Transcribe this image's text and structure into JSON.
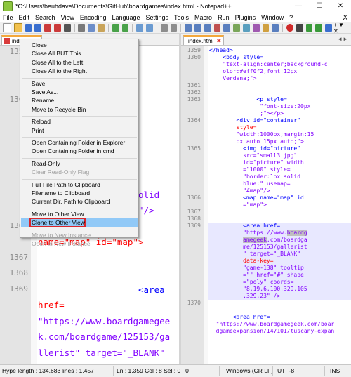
{
  "window": {
    "title": "*C:\\Users\\beuhdave\\Documents\\GitHub\\boardgames\\index.html - Notepad++"
  },
  "menu": [
    "File",
    "Edit",
    "Search",
    "View",
    "Encoding",
    "Language",
    "Settings",
    "Tools",
    "Macro",
    "Run",
    "Plugins",
    "Window",
    "?"
  ],
  "menu_close": "X",
  "toolbar_right_label": "+ ▼ ✕",
  "tabs": {
    "left": {
      "label": "index.h",
      "close": "✖"
    },
    "right": {
      "label": "index.html",
      "close": "✖"
    },
    "nav": "◄►"
  },
  "left_editor": {
    "lines": [
      {
        "num": "1359",
        "frag": [
          {
            "t": "",
            "c": "txt"
          }
        ]
      },
      {
        "num": "",
        "frag": [
          {
            "t": "r;ba",
            "c": "txt"
          }
        ]
      },
      {
        "num": "",
        "frag": [
          {
            "t": "eff0f",
            "c": "txt"
          }
        ]
      },
      {
        "num": "1360",
        "frag": []
      },
      {
        "num": "",
        "frag": [
          {
            "t": "<p",
            "c": "tag"
          }
        ]
      },
      {
        "num": "",
        "frag": [
          {
            "t": "x;\"",
            "c": "val"
          }
        ]
      },
      {
        "num": "",
        "frag": [
          {
            "t": ":15px",
            "c": "val"
          }
        ]
      },
      {
        "num": "",
        "frag": [
          {
            "t": "\" id=",
            "c": "attr"
          }
        ]
      },
      {
        "num": "",
        "frag": [
          {
            "t": "0\"",
            "c": "val"
          }
        ]
      },
      {
        "num": "",
        "frag": [
          {
            "t": "style=\"border:1px solid",
            "c": "val"
          }
        ]
      },
      {
        "num": "",
        "frag": [
          {
            "t": "blue;\" usemap=\"#map\"/>",
            "c": "val"
          }
        ]
      },
      {
        "num": "1366",
        "frag": [
          {
            "t": "               <map",
            "c": "tag"
          }
        ]
      },
      {
        "num": "",
        "frag": [
          {
            "t": "name=\"map\" id=\"map\">",
            "c": "attr"
          }
        ]
      },
      {
        "num": "1367",
        "frag": []
      },
      {
        "num": "1368",
        "frag": []
      },
      {
        "num": "1369",
        "frag": [
          {
            "t": "                   <area",
            "c": "tag"
          }
        ]
      },
      {
        "num": "",
        "frag": [
          {
            "t": "href=",
            "c": "attr"
          }
        ]
      },
      {
        "num": "",
        "frag": [
          {
            "t": "\"https://www.boardgamegee",
            "c": "val"
          }
        ]
      },
      {
        "num": "",
        "frag": [
          {
            "t": "k.com/boardgame/125153/ga",
            "c": "val"
          }
        ]
      },
      {
        "num": "",
        "frag": [
          {
            "t": "llerist\" target=\"_BLANK\"",
            "c": "val"
          }
        ]
      }
    ]
  },
  "right_editor": {
    "lines": [
      {
        "num": "1359",
        "frag": [
          {
            "t": "</head>",
            "c": "tag"
          }
        ]
      },
      {
        "num": "1360",
        "frag": [
          {
            "t": "    <body style=",
            "c": "tag"
          }
        ]
      },
      {
        "num": "",
        "frag": [
          {
            "t": "    \"text-align:center;background-c",
            "c": "val"
          }
        ]
      },
      {
        "num": "",
        "frag": [
          {
            "t": "    olor:#eff0f2;font:12px",
            "c": "val"
          }
        ]
      },
      {
        "num": "",
        "frag": [
          {
            "t": "    Verdana;\">",
            "c": "val"
          }
        ]
      },
      {
        "num": "1361",
        "frag": []
      },
      {
        "num": "1362",
        "frag": []
      },
      {
        "num": "1363",
        "frag": [
          {
            "t": "              <p style=",
            "c": "tag"
          }
        ]
      },
      {
        "num": "",
        "frag": [
          {
            "t": "               \"font-size:20px",
            "c": "val"
          }
        ]
      },
      {
        "num": "",
        "frag": [
          {
            "t": "               ;\"></p>",
            "c": "val"
          }
        ]
      },
      {
        "num": "1364",
        "frag": [
          {
            "t": "        <div id=\"container\"",
            "c": "tag"
          }
        ]
      },
      {
        "num": "",
        "frag": [
          {
            "t": "        style=",
            "c": "attr"
          }
        ]
      },
      {
        "num": "",
        "frag": [
          {
            "t": "        \"width:1000px;margin:15",
            "c": "val"
          }
        ]
      },
      {
        "num": "",
        "frag": [
          {
            "t": "        px auto 15px auto;\">",
            "c": "val"
          }
        ]
      },
      {
        "num": "1365",
        "frag": [
          {
            "t": "          <img id=\"picture\"",
            "c": "tag"
          }
        ]
      },
      {
        "num": "",
        "frag": [
          {
            "t": "          src=\"small3.jpg\"",
            "c": "val"
          }
        ]
      },
      {
        "num": "",
        "frag": [
          {
            "t": "          id=\"picture\" width",
            "c": "val"
          }
        ]
      },
      {
        "num": "",
        "frag": [
          {
            "t": "          =\"1000\" style=",
            "c": "val"
          }
        ]
      },
      {
        "num": "",
        "frag": [
          {
            "t": "          \"border:1px solid",
            "c": "val"
          }
        ]
      },
      {
        "num": "",
        "frag": [
          {
            "t": "          blue;\" usemap=",
            "c": "val"
          }
        ]
      },
      {
        "num": "",
        "frag": [
          {
            "t": "          \"#map\"/>",
            "c": "val"
          }
        ]
      },
      {
        "num": "1366",
        "frag": [
          {
            "t": "          <map name=\"map\" id",
            "c": "tag"
          }
        ]
      },
      {
        "num": "",
        "frag": [
          {
            "t": "          =\"map\">",
            "c": "val"
          }
        ]
      },
      {
        "num": "1367",
        "frag": []
      },
      {
        "num": "1368",
        "frag": []
      },
      {
        "num": "1369",
        "frag": [
          {
            "t": "          <area href=",
            "c": "tag"
          }
        ]
      },
      {
        "num": "",
        "frag": [
          {
            "t": "          \"https://www.",
            "c": "val"
          },
          {
            "t": "boardg",
            "c": "val sel"
          }
        ]
      },
      {
        "num": "",
        "frag": [
          {
            "t": "          ",
            "c": "val"
          },
          {
            "t": "amegeek",
            "c": "val sel"
          },
          {
            "t": ".com/boardga",
            "c": "val"
          }
        ]
      },
      {
        "num": "",
        "frag": [
          {
            "t": "          me/125153/gallerist",
            "c": "val"
          }
        ]
      },
      {
        "num": "",
        "frag": [
          {
            "t": "          \" target=\"_BLANK\"",
            "c": "val"
          }
        ]
      },
      {
        "num": "",
        "frag": [
          {
            "t": "          data-key=",
            "c": "attr"
          }
        ]
      },
      {
        "num": "",
        "frag": [
          {
            "t": "          \"game-138\" tooltip",
            "c": "val"
          }
        ]
      },
      {
        "num": "",
        "frag": [
          {
            "t": "          =\"\" href=\"#\" shape",
            "c": "val"
          }
        ]
      },
      {
        "num": "",
        "frag": [
          {
            "t": "          =\"poly\" coords=",
            "c": "val"
          }
        ]
      },
      {
        "num": "",
        "frag": [
          {
            "t": "          \"8,19,6,100,329,105",
            "c": "val"
          }
        ]
      },
      {
        "num": "",
        "frag": [
          {
            "t": "          ,329,23\" />",
            "c": "val"
          }
        ]
      },
      {
        "num": "1370",
        "frag": []
      },
      {
        "num": "",
        "frag": []
      },
      {
        "num": "",
        "frag": [
          {
            "t": "       <area href=",
            "c": "tag"
          }
        ]
      },
      {
        "num": "",
        "frag": [
          {
            "t": "  \"https://www.boardgamegeek.com/boar",
            "c": "val"
          }
        ]
      },
      {
        "num": "",
        "frag": [
          {
            "t": "  dgameexpansion/147101/tuscany-expan",
            "c": "val"
          }
        ]
      }
    ]
  },
  "context_menu": {
    "items": [
      {
        "label": "Close",
        "enabled": true
      },
      {
        "label": "Close All BUT This",
        "enabled": true
      },
      {
        "label": "Close All to the Left",
        "enabled": true
      },
      {
        "label": "Close All to the Right",
        "enabled": true
      },
      {
        "label": "Save",
        "enabled": true
      },
      {
        "label": "Save As...",
        "enabled": true
      },
      {
        "label": "Rename",
        "enabled": true
      },
      {
        "label": "Move to Recycle Bin",
        "enabled": true
      },
      {
        "label": "Reload",
        "enabled": true
      },
      {
        "label": "Print",
        "enabled": true
      },
      {
        "label": "Open Containing Folder in Explorer",
        "enabled": true
      },
      {
        "label": "Open Containing Folder in cmd",
        "enabled": true
      },
      {
        "label": "Read-Only",
        "enabled": true
      },
      {
        "label": "Clear Read-Only Flag",
        "enabled": false
      },
      {
        "label": "Full File Path to Clipboard",
        "enabled": true
      },
      {
        "label": "Filename to Clipboard",
        "enabled": true
      },
      {
        "label": "Current Dir. Path to Clipboard",
        "enabled": true
      },
      {
        "label": "Move to Other View",
        "enabled": true
      },
      {
        "label": "Clone to Other View",
        "enabled": true,
        "highlighted": true
      },
      {
        "label": "Move to New Instance",
        "enabled": false
      },
      {
        "label": "Open in New Instance",
        "enabled": false
      }
    ]
  },
  "status": {
    "length": "Hype length : 134,683",
    "lines": "lines : 1,457",
    "pos": "Ln : 1,359   Col : 8   Sel : 0 | 0",
    "eol": "Windows (CR LF)",
    "enc": "UTF-8",
    "mode": "INS"
  },
  "colors": {
    "tag": "#0000ff",
    "attr": "#ff0000",
    "value": "#8000ff",
    "highlight_line": "#e8e8ff",
    "menu_highlight": "#91c9f7",
    "annotation_box": "#d9262b"
  }
}
